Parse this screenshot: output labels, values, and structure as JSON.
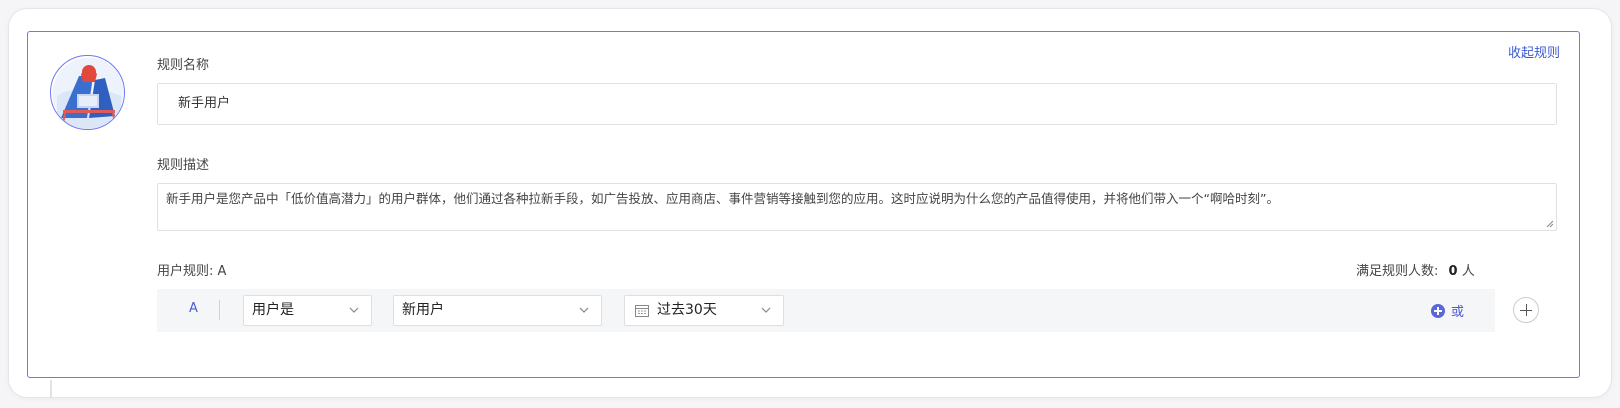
{
  "header": {
    "collapse_link": "收起规则"
  },
  "avatar": {
    "icon": "person-at-desk-illustration"
  },
  "rule_name": {
    "label": "规则名称",
    "value": "新手用户"
  },
  "rule_description": {
    "label": "规则描述",
    "value": "新手用户是您产品中「低价值高潜力」的用户群体，他们通过各种拉新手段，如广告投放、应用商店、事件营销等接触到您的应用。这时应说明为什么您的产品值得使用，并将他们带入一个“啊哈时刻”。"
  },
  "user_rules": {
    "label": "用户规则: A",
    "satisfied_label": "满足规则人数:",
    "satisfied_count": "0",
    "satisfied_unit": "人"
  },
  "condition": {
    "tag": "A",
    "attribute_select": "用户是",
    "value_select": "新用户",
    "date_select": "过去30天",
    "or_button": "或"
  },
  "colors": {
    "accent": "#6f78ef",
    "link": "#3f5bd4",
    "row_bg": "#f5f6f8"
  }
}
